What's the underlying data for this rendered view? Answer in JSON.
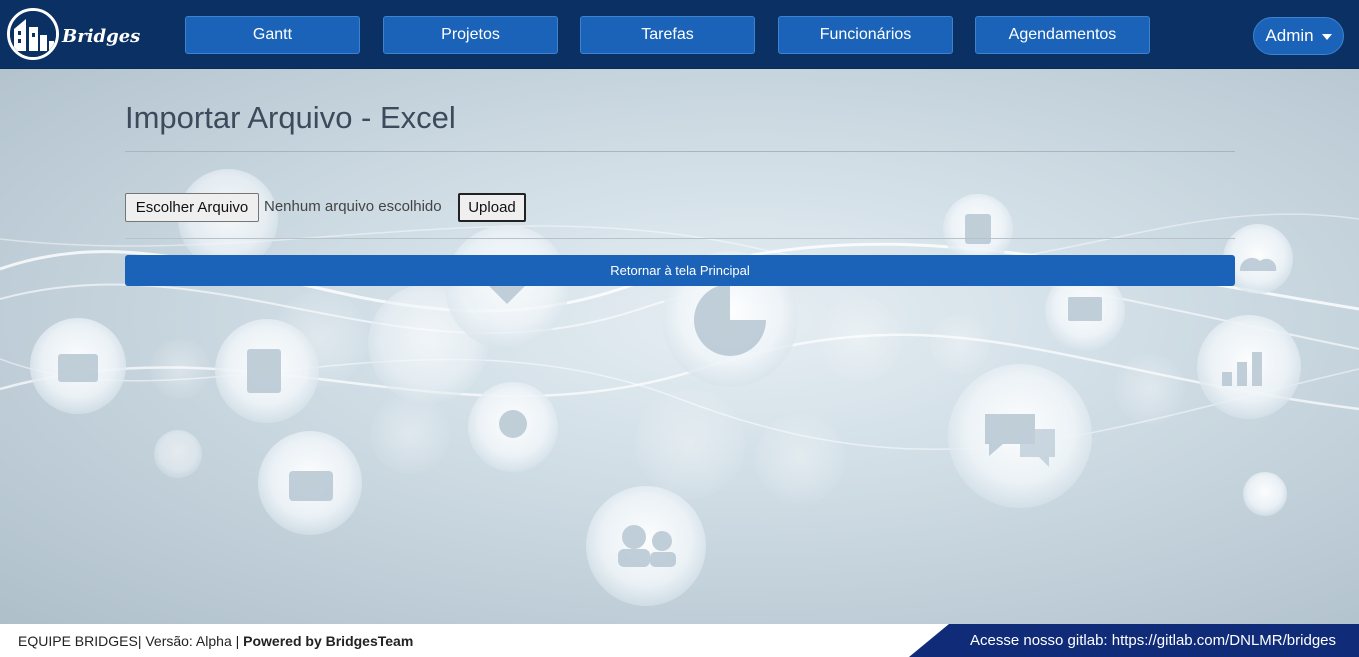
{
  "brand": {
    "name": "Bridges"
  },
  "nav": {
    "items": [
      {
        "label": "Gantt"
      },
      {
        "label": "Projetos"
      },
      {
        "label": "Tarefas"
      },
      {
        "label": "Funcionários"
      },
      {
        "label": "Agendamentos"
      }
    ],
    "user_menu_label": "Admin"
  },
  "page": {
    "title": "Importar Arquivo - Excel",
    "file_input": {
      "button_label": "Escolher Arquivo",
      "status_text": "Nenhum arquivo escolhido"
    },
    "upload_label": "Upload",
    "return_label": "Retornar à tela Principal"
  },
  "footer": {
    "team": "EQUIPE BRIDGES",
    "version_text": "| Versão: Alpha |",
    "powered_by": "Powered by BridgesTeam",
    "gitlab_text": "Acesse nosso gitlab: https://gitlab.com/DNLMR/bridges"
  },
  "colors": {
    "navbar": "#0b3064",
    "nav_button": "#1a63b8",
    "footer_badge": "#102c79",
    "title": "#3d4a5c"
  },
  "icons": [
    "bridges-logo-icon",
    "chevron-down-icon"
  ]
}
